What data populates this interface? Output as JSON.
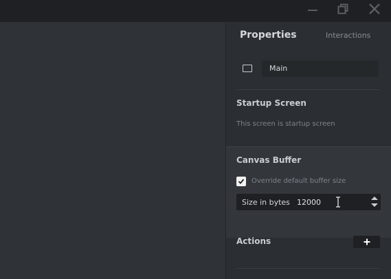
{
  "window": {
    "controls": {
      "minimize_icon": "minimize-icon",
      "restore_icon": "restore-icon",
      "close_icon": "close-icon"
    }
  },
  "panel": {
    "tabs": [
      {
        "label": "Properties",
        "active": true
      },
      {
        "label": "Interactions",
        "active": false
      }
    ],
    "screen": {
      "icon": "screen-icon",
      "name": "Main"
    },
    "startup": {
      "title": "Startup Screen",
      "description": "This screen is startup screen"
    },
    "canvas_buffer": {
      "title": "Canvas Buffer",
      "override_label": "Override default buffer size",
      "override_checked": true,
      "size_label": "Size in bytes",
      "size_value": "12000"
    },
    "actions": {
      "title": "Actions",
      "add_icon": "plus-icon"
    }
  },
  "colors": {
    "titlebar": "#1e2023",
    "canvas": "#2f3237",
    "panel": "#2b2e32",
    "section_highlight": "#33363b",
    "field_bg": "#1e2023"
  }
}
